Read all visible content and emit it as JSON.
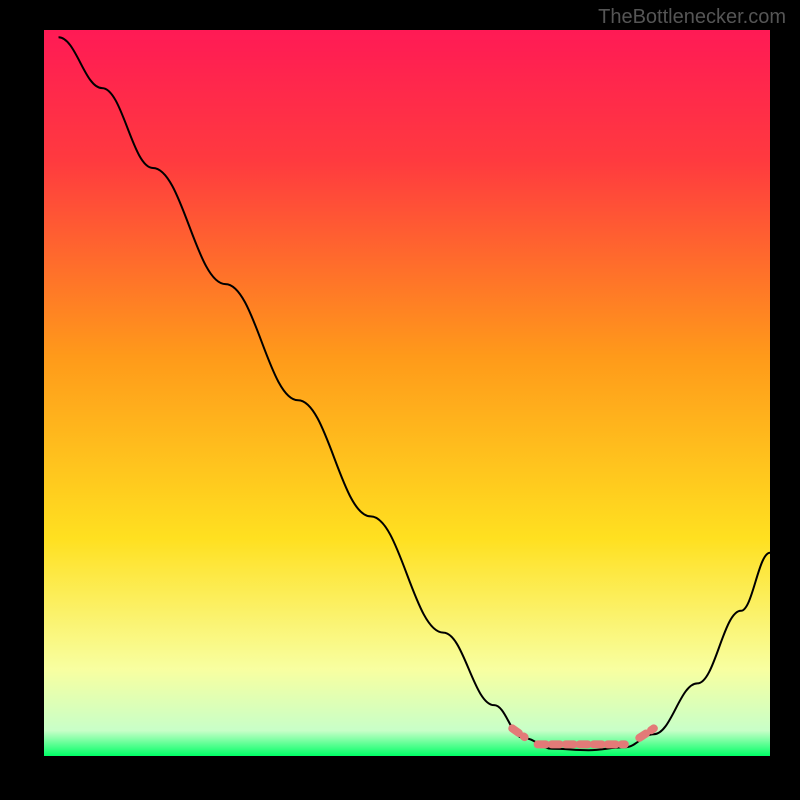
{
  "watermark": "TheBottlenecker.com",
  "chart_data": {
    "type": "line",
    "title": "",
    "xlabel": "",
    "ylabel": "",
    "xlim": [
      0,
      100
    ],
    "ylim": [
      0,
      100
    ],
    "gradient_stops": [
      {
        "offset": 0,
        "color": "#ff1a55"
      },
      {
        "offset": 18,
        "color": "#ff3a3f"
      },
      {
        "offset": 45,
        "color": "#ff9a1a"
      },
      {
        "offset": 70,
        "color": "#ffe020"
      },
      {
        "offset": 88,
        "color": "#f8ffa0"
      },
      {
        "offset": 96.5,
        "color": "#c8ffc8"
      },
      {
        "offset": 100,
        "color": "#00ff66"
      }
    ],
    "series": [
      {
        "name": "bottleneck-curve",
        "points": [
          {
            "x": 2,
            "y": 99
          },
          {
            "x": 8,
            "y": 92
          },
          {
            "x": 15,
            "y": 81
          },
          {
            "x": 25,
            "y": 65
          },
          {
            "x": 35,
            "y": 49
          },
          {
            "x": 45,
            "y": 33
          },
          {
            "x": 55,
            "y": 17
          },
          {
            "x": 62,
            "y": 7
          },
          {
            "x": 66,
            "y": 2.5
          },
          {
            "x": 70,
            "y": 1
          },
          {
            "x": 75,
            "y": 0.8
          },
          {
            "x": 80,
            "y": 1.2
          },
          {
            "x": 84,
            "y": 3
          },
          {
            "x": 90,
            "y": 10
          },
          {
            "x": 96,
            "y": 20
          },
          {
            "x": 100,
            "y": 28
          }
        ]
      },
      {
        "name": "marker-band",
        "color": "#e37a78",
        "segments": [
          {
            "x1": 64.5,
            "y1": 3.8,
            "x2": 66.2,
            "y2": 2.6
          },
          {
            "x1": 68.0,
            "y1": 1.6,
            "x2": 80.0,
            "y2": 1.6
          },
          {
            "x1": 82.0,
            "y1": 2.5,
            "x2": 84.0,
            "y2": 3.8
          }
        ]
      }
    ]
  }
}
